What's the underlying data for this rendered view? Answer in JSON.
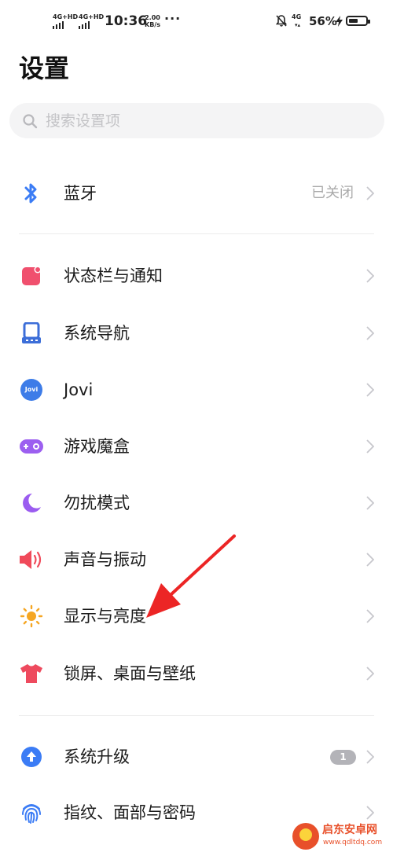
{
  "status_bar": {
    "network1": "4G+HD",
    "network2": "4G+HD",
    "time": "10:36",
    "speed_value": "2.00",
    "speed_unit": "KB/s",
    "more": "···",
    "network3": "4G",
    "battery_percent": "56%",
    "battery_level": 0.56
  },
  "page": {
    "title": "设置"
  },
  "search": {
    "placeholder": "搜索设置项"
  },
  "items": [
    {
      "label": "蓝牙",
      "value": "已关闭",
      "icon": "bluetooth-icon",
      "color": "#3b7cf5"
    },
    {
      "label": "状态栏与通知",
      "icon": "notification-icon",
      "color": "#f0506e"
    },
    {
      "label": "系统导航",
      "icon": "navigation-icon",
      "color": "#3c6ed8"
    },
    {
      "label": "Jovi",
      "icon": "jovi-icon",
      "icon_text": "Jovi",
      "color": "#3d7ce8"
    },
    {
      "label": "游戏魔盒",
      "icon": "gamepad-icon",
      "color": "#9c5ff0"
    },
    {
      "label": "勿扰模式",
      "icon": "moon-icon",
      "color": "#9b5cf0"
    },
    {
      "label": "声音与振动",
      "icon": "speaker-icon",
      "color": "#f04a5a"
    },
    {
      "label": "显示与亮度",
      "icon": "sun-icon",
      "color": "#f5a623"
    },
    {
      "label": "锁屏、桌面与壁纸",
      "icon": "tshirt-icon",
      "color": "#ee4a5e"
    },
    {
      "label": "系统升级",
      "badge": "1",
      "icon": "upgrade-icon",
      "color": "#3b7cf5"
    },
    {
      "label": "指纹、面部与密码",
      "icon": "fingerprint-icon",
      "color": "#3b7cf5"
    }
  ],
  "watermark": {
    "name": "启东安卓网",
    "url": "www.qdltdq.com"
  }
}
